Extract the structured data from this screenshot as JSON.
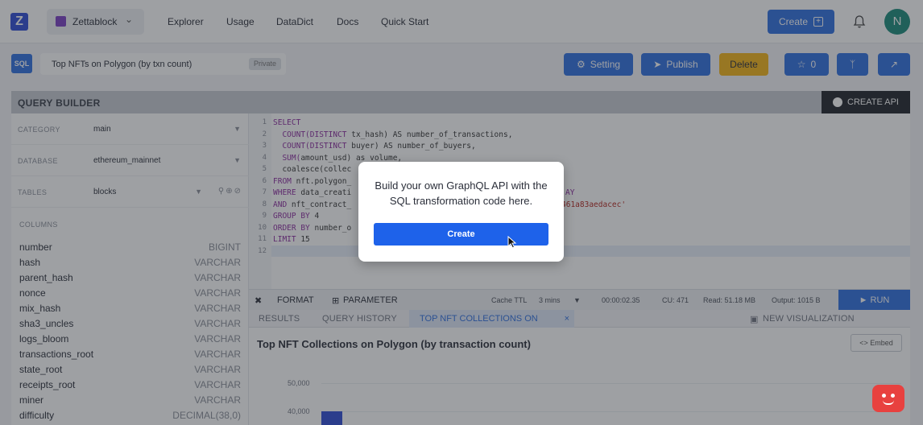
{
  "nav": {
    "workspace": "Zettablock",
    "links": [
      "Explorer",
      "Usage",
      "DataDict",
      "Docs",
      "Quick Start"
    ],
    "create_label": "Create",
    "avatar_initial": "N"
  },
  "query": {
    "badge": "SQL",
    "title": "Top NFTs on Polygon (by txn count)",
    "visibility": "Private",
    "setting_label": "Setting",
    "publish_label": "Publish",
    "delete_label": "Delete",
    "star_count": "0"
  },
  "builder": {
    "title": "QUERY BUILDER",
    "create_api_label": "CREATE API",
    "filters": [
      {
        "label": "CATEGORY",
        "value": "main"
      },
      {
        "label": "DATABASE",
        "value": "ethereum_mainnet"
      },
      {
        "label": "TABLES",
        "value": "blocks"
      }
    ],
    "columns_label": "COLUMNS",
    "columns": [
      {
        "name": "number",
        "type": "BIGINT"
      },
      {
        "name": "hash",
        "type": "VARCHAR"
      },
      {
        "name": "parent_hash",
        "type": "VARCHAR"
      },
      {
        "name": "nonce",
        "type": "VARCHAR"
      },
      {
        "name": "mix_hash",
        "type": "VARCHAR"
      },
      {
        "name": "sha3_uncles",
        "type": "VARCHAR"
      },
      {
        "name": "logs_bloom",
        "type": "VARCHAR"
      },
      {
        "name": "transactions_root",
        "type": "VARCHAR"
      },
      {
        "name": "state_root",
        "type": "VARCHAR"
      },
      {
        "name": "receipts_root",
        "type": "VARCHAR"
      },
      {
        "name": "miner",
        "type": "VARCHAR"
      },
      {
        "name": "difficulty",
        "type": "DECIMAL(38,0)"
      }
    ]
  },
  "editor": {
    "line_numbers": [
      "1",
      "2",
      "3",
      "4",
      "5",
      "6",
      "7",
      "8",
      "9",
      "10",
      "11",
      "12"
    ],
    "lines": [
      {
        "kw": "SELECT",
        "rest": ""
      },
      {
        "kw": "  COUNT(DISTINCT",
        "rest": " tx_hash) AS number_of_transactions,"
      },
      {
        "kw": "  COUNT(DISTINCT",
        "rest": " buyer) AS number_of_buyers,"
      },
      {
        "kw": "  SUM(",
        "rest": "amount_usd) as volume,"
      },
      {
        "kw": "",
        "rest": "  coalesce(collec"
      },
      {
        "kw": "FROM",
        "rest": " nft.polygon_"
      },
      {
        "kw": "WHERE",
        "rest": " data_creati"
      },
      {
        "kw": "AND",
        "rest": " nft_contract_"
      },
      {
        "kw": "GROUP BY",
        "rest": " 4"
      },
      {
        "kw": "ORDER BY",
        "rest": " number_o"
      },
      {
        "kw": "LIMIT",
        "rest": " 15"
      },
      {
        "kw": "",
        "rest": ""
      }
    ],
    "frag_ay": "AY",
    "frag_str": "461a83aedacec'"
  },
  "toolbar": {
    "format": "FORMAT",
    "parameter": "PARAMETER",
    "cache_label": "Cache TTL",
    "cache_value": "3 mins",
    "elapsed": "00:00:02.35",
    "cu": "CU: 471",
    "read": "Read: 51.18 MB",
    "output": "Output: 1015 B",
    "run": "RUN"
  },
  "results": {
    "tabs": [
      "RESULTS",
      "QUERY HISTORY"
    ],
    "active_tab": "TOP NFT COLLECTIONS ON POLYGON (BY TRANSACTION COUNT)",
    "new_tab": "NEW VISUALIZATION",
    "chart_title": "Top NFT Collections on Polygon (by transaction count)",
    "embed_label": "<> Embed",
    "ticks": [
      "50,000",
      "40,000"
    ]
  },
  "modal": {
    "text": "Build your own GraphQL API with the SQL transformation code here.",
    "button": "Create"
  }
}
